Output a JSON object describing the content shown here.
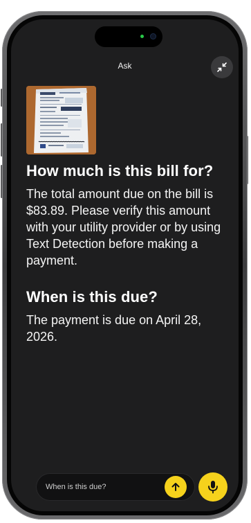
{
  "colors": {
    "accent": "#f6d21c",
    "background": "#1e1e1f",
    "text": "#ffffff"
  },
  "header": {
    "title": "Ask",
    "collapse_icon": "collapse-arrows-icon"
  },
  "attachment": {
    "icon": "bill-photo-thumbnail"
  },
  "conversation": [
    {
      "question": "How much is this bill for?",
      "answer": "The total amount due on the bill is $83.89. Please verify this amount with your utility provider or by using Text Detection before making a payment."
    },
    {
      "question": "When is this due?",
      "answer": "The payment is due on April 28, 2026."
    }
  ],
  "composer": {
    "input_value": "When is this due?",
    "send_icon": "arrow-up-icon",
    "mic_icon": "microphone-icon"
  }
}
